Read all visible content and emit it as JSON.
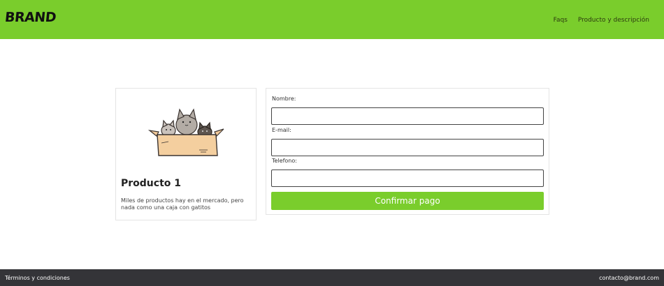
{
  "header": {
    "brand": "BRAND",
    "nav": [
      "Faqs",
      "Producto y descripción"
    ]
  },
  "product": {
    "image_icon": "cats-in-box-illustration",
    "title": "Producto 1",
    "description": "Miles de productos hay en el mercado, pero nada como una caja con gatitos"
  },
  "form": {
    "name_label": "Nombre:",
    "name_value": "",
    "email_label": "E-mail:",
    "email_value": "",
    "phone_label": "Telefono:",
    "phone_value": "",
    "submit_label": "Confirmar pago"
  },
  "footer": {
    "terms": "Términos y condiciones",
    "contact": "contacto@brand.com"
  },
  "colors": {
    "accent": "#7acd2c",
    "footer_bg": "#343438"
  }
}
